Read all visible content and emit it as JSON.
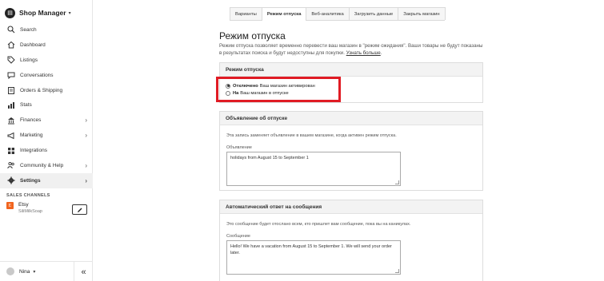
{
  "app": {
    "title": "Shop Manager",
    "caret": "▾"
  },
  "nav": [
    {
      "label": "Search",
      "icon": "search-icon",
      "chevron": ""
    },
    {
      "label": "Dashboard",
      "icon": "home-icon",
      "chevron": ""
    },
    {
      "label": "Listings",
      "icon": "tag-icon",
      "chevron": ""
    },
    {
      "label": "Conversations",
      "icon": "chat-icon",
      "chevron": ""
    },
    {
      "label": "Orders & Shipping",
      "icon": "clipboard-icon",
      "chevron": ""
    },
    {
      "label": "Stats",
      "icon": "bar-chart-icon",
      "chevron": ""
    },
    {
      "label": "Finances",
      "icon": "bank-icon",
      "chevron": "›"
    },
    {
      "label": "Marketing",
      "icon": "megaphone-icon",
      "chevron": "›"
    },
    {
      "label": "Integrations",
      "icon": "grid-icon",
      "chevron": ""
    },
    {
      "label": "Community & Help",
      "icon": "people-icon",
      "chevron": "›"
    },
    {
      "label": "Settings",
      "icon": "gear-icon",
      "chevron": "›"
    }
  ],
  "active_nav": "Settings",
  "sales_channels": {
    "label": "SALES CHANNELS",
    "channel_name": "Etsy",
    "channel_sub": "SiliMilkSoap",
    "logo_letter": "E"
  },
  "user": {
    "name": "Nina",
    "caret": "▾",
    "collapse": "«"
  },
  "tabs": [
    "Варианты",
    "Режим отпуска",
    "Веб-аналитика",
    "Загрузить данные",
    "Закрыть магазин"
  ],
  "active_tab": "Режим отпуска",
  "page": {
    "title": "Режим отпуска",
    "description": "Режим отпуска позволяет временно перевести ваш магазин в \"режим ожидания\". Ваши товары не будут показаны в результатах поиска и будут недоступны для покупки.",
    "learn_more": "Узнать больше",
    "period": "."
  },
  "vacation_mode": {
    "heading": "Режим отпуска",
    "options": [
      {
        "bold": "Отключено",
        "text": "Ваш магазин активирован",
        "selected": true
      },
      {
        "bold": "На",
        "text": "Ваш магазин в отпуске",
        "selected": false
      }
    ]
  },
  "announcement": {
    "heading": "Объявление об отпуске",
    "hint": "Эта запись заменяет объявление в вашем магазине, когда активен режим отпуска.",
    "field_label": "Объявление",
    "value": "holidays from August 15 to September 1"
  },
  "auto_reply": {
    "heading": "Автоматический ответ на сообщения",
    "hint": "Это сообщение будет отослано всем, кто пришлет вам сообщение, пока вы на каникулах.",
    "field_label": "Сообщение",
    "value": "Hello! We have a vacation from August 15 to September 1. We will send your order later."
  },
  "colors": {
    "highlight": "#e01b24",
    "etsy": "#f1641e"
  }
}
